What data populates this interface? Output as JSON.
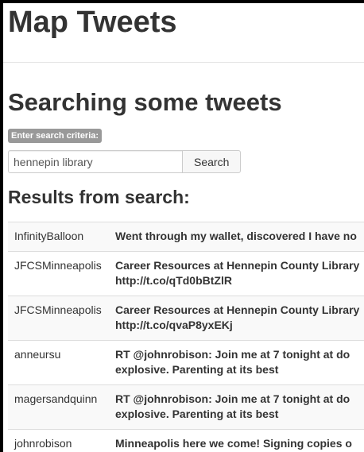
{
  "app": {
    "title": "Map Tweets"
  },
  "page": {
    "title": "Searching some tweets"
  },
  "search": {
    "label": "Enter search criteria:",
    "value": "hennepin library",
    "button_label": "Search"
  },
  "results": {
    "title": "Results from search:",
    "rows": [
      {
        "user": "InfinityBalloon",
        "lines": [
          "Went through my wallet, discovered I have no"
        ]
      },
      {
        "user": "JFCSMinneapolis",
        "lines": [
          "Career Resources at Hennepin County Library",
          "http://t.co/qTd0bBtZlR"
        ]
      },
      {
        "user": "JFCSMinneapolis",
        "lines": [
          "Career Resources at Hennepin County Library",
          "http://t.co/qvaP8yxEKj"
        ]
      },
      {
        "user": "anneursu",
        "lines": [
          "RT @johnrobison: Join me at 7 tonight at do",
          "explosive. Parenting at its best"
        ]
      },
      {
        "user": "magersandquinn",
        "lines": [
          "RT @johnrobison: Join me at 7 tonight at do",
          "explosive. Parenting at its best"
        ]
      },
      {
        "user": "johnrobison",
        "lines": [
          "Minneapolis here we come! Signing copies o"
        ]
      }
    ]
  }
}
